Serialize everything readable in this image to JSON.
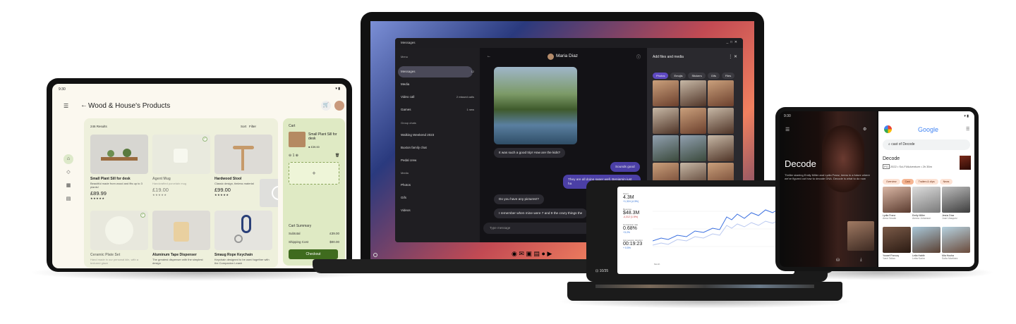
{
  "tablet_left": {
    "time": "9:30",
    "title": "Wood & House's Products",
    "results": "246 Results",
    "sort": "Sort",
    "filter": "Filter",
    "products": [
      {
        "name": "Small Plant Sill for desk",
        "desc": "Beautiful made from wood and fits up to 3 plants!",
        "price": "£89.99",
        "stars": "★★★★★"
      },
      {
        "name": "Agent Mug",
        "desc": "Handcrafted porcelain mug",
        "price": "£19.00",
        "stars": "★★★★★"
      },
      {
        "name": "Hardwood Stool",
        "desc": "Classic design, timless material",
        "price": "£99.00",
        "stars": "★★★★★"
      },
      {
        "name": "Ceramic Plate Set",
        "desc": "Hand made in our personal kiln, with a textured glaze",
        "price": "",
        "stars": ""
      },
      {
        "name": "Aluminum Tape Dispenser",
        "desc": "The greatest dispenser with the simplest design",
        "price": "",
        "stars": ""
      },
      {
        "name": "Smaug Rope Keychain",
        "desc": "Keychain designed to be used together with the Companion Leash",
        "price": "",
        "stars": ""
      }
    ],
    "cart": {
      "title": "Cart",
      "item_name": "Small Plant Sill for desk",
      "item_price": "£39.00",
      "qty": "1",
      "add": "+",
      "summary_title": "Cart Summary",
      "subtotal_label": "Subtotal",
      "subtotal": "£39.00",
      "shipping_label": "Shipping Cost",
      "shipping": "$00.00",
      "checkout": "Checkout"
    }
  },
  "laptop": {
    "window_title": "Messages",
    "menu": "Menu",
    "nav": [
      {
        "label": "Messages",
        "count": "12"
      },
      {
        "label": "Media",
        "count": ""
      },
      {
        "label": "Video call",
        "count": "2 missed calls"
      },
      {
        "label": "Games",
        "count": "1 new"
      }
    ],
    "group_chats_header": "Group chats",
    "groups": [
      "Walking Weekend 2023",
      "Buxton family chat",
      "Pedal crew"
    ],
    "media_header": "Media",
    "media": [
      "Photos",
      "Gifs",
      "Videos"
    ],
    "contact": "Maria Diaz",
    "messages": [
      {
        "text": "It was such a good trip! How are the kids?",
        "me": false
      },
      {
        "text": "Sounds good",
        "me": true
      },
      {
        "text": "They are all doing super well, Benjamin just ha",
        "me": true
      },
      {
        "text": "Do you have any pictures!?",
        "me": false
      },
      {
        "text": "I remember when mine were 7 and 9 the crazy things the",
        "me": false
      }
    ],
    "composer_placeholder": "Type message",
    "panel_title": "Add files and media",
    "panel_tabs": [
      "Photos",
      "Emojis",
      "Stickers",
      "Gifs",
      "Files"
    ]
  },
  "foldable": {
    "counter": "10/35",
    "stats": [
      {
        "label": "Users",
        "value": "4.3M",
        "delta": "+1,324 (4.3%)"
      },
      {
        "label": "Revenue",
        "value": "$48.3M",
        "delta": "-4,312 (1.5%)"
      },
      {
        "label": "Conversion rate",
        "value": "0.68%",
        "delta": "+3.2%"
      },
      {
        "label": "Avg session duration",
        "value": "00:19:23",
        "delta": "+ 0.5%"
      }
    ],
    "x_label": "Month"
  },
  "tablet_right": {
    "time": "9:30",
    "movie_title": "Decode",
    "movie_desc": "Thriller starring Emily Miller and Lydia Franz, teens in a future where we've figured out how to decode DNA. Decode is what to do now",
    "search_value": "cast of Decode",
    "google": "Google",
    "result_title": "Decode",
    "result_meta": "2022 • Sci-Fi/Adventure • 2h 35m",
    "rating": "PG",
    "pills": [
      "Overview",
      "Cast",
      "Trailers & clips",
      "News"
    ],
    "cast": [
      {
        "name": "Lydia Franz",
        "role": "Anna Novak"
      },
      {
        "name": "Emily Miller",
        "role": "Amma Johanson"
      },
      {
        "name": "Jesús Díaz",
        "role": "Juan Vasquez"
      },
      {
        "name": "Yousef Farouq",
        "role": "Yash Tailan"
      },
      {
        "name": "Leila Habib",
        "role": "Letta Karim"
      },
      {
        "name": "Mia Houha",
        "role": "Sofia Martinez"
      }
    ]
  }
}
